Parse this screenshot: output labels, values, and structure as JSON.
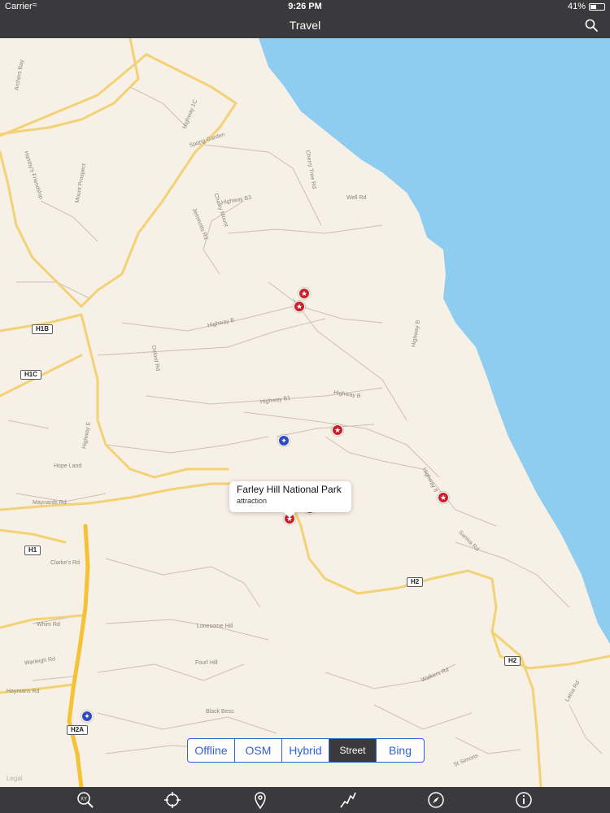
{
  "status": {
    "carrier": "Carrier",
    "time": "9:26 PM",
    "battery": "41%"
  },
  "nav": {
    "title": "Travel"
  },
  "map": {
    "legal": "Legal",
    "roads": {
      "r1": "Highway 1C",
      "r2": "Spring Garden",
      "r3": "Mount Prospect",
      "r4": "Hamby's Friendship",
      "r5": "Jemmotts Rd",
      "r6": "Chalky Mount",
      "r7": "Highway B3",
      "r8": "Well Rd",
      "r9": "Highway B",
      "r10": "Oxford Rd",
      "r11": "Highway B",
      "r12": "Highway 8",
      "r13": "Highway B",
      "r14": "Maynards Rd",
      "r15": "Clarke's Rd",
      "r16": "Whim Rd",
      "r17": "Lonesome Hill",
      "r18": "Fourl Hill",
      "r19": "Haymans Rd",
      "r20": "Black Bess",
      "r21": "Walkers Rd",
      "r22": "St Simons",
      "r23": "Saniva Rd",
      "r24": "Latoa Rd",
      "r25": "Highway E",
      "r26": "Hope Land",
      "r27": "Cherry Tree Rd",
      "r28": "Archers Bay",
      "r29": "Highway B1",
      "r30": "Warleigh Rd"
    },
    "shields": {
      "h1b": "H1B",
      "h1c": "H1C",
      "h1": "H1",
      "h2a": "H2A",
      "h2_east": "H2",
      "h2_mid": "H2"
    },
    "callout": {
      "title": "Farley Hill National Park",
      "subtitle": "attraction"
    },
    "pins": [
      {
        "type": "attraction",
        "glyph": "star-icon"
      },
      {
        "type": "attraction",
        "glyph": "star-icon"
      },
      {
        "type": "attraction",
        "glyph": "star-icon"
      },
      {
        "type": "attraction",
        "glyph": "star-icon"
      },
      {
        "type": "attraction",
        "glyph": "star-icon"
      },
      {
        "type": "attraction",
        "glyph": "star-icon"
      },
      {
        "type": "food",
        "glyph": "fork-knife-icon"
      },
      {
        "type": "food",
        "glyph": "fork-knife-icon"
      }
    ],
    "colors": {
      "land": "#f7f0e6",
      "water": "#8ecdf0",
      "highway": "#f2d274",
      "motorway": "#f4c235",
      "minor": "#c9c1b4"
    }
  },
  "map_type": {
    "options": [
      "Offline",
      "OSM",
      "Hybrid",
      "Street",
      "Bing"
    ],
    "selected": "Street"
  },
  "tabs": [
    "coordinate-search-icon",
    "crosshair-icon",
    "location-pin-icon",
    "route-icon",
    "compass-icon",
    "info-icon"
  ]
}
